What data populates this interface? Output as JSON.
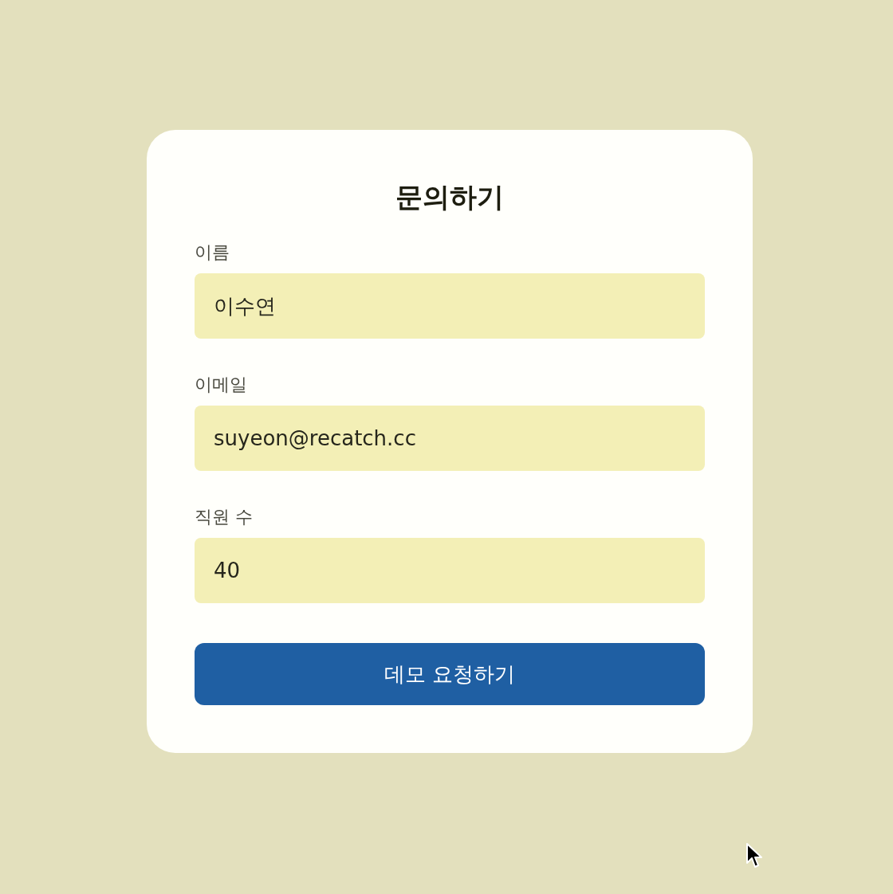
{
  "form": {
    "title": "문의하기",
    "fields": [
      {
        "label": "이름",
        "value": "이수연"
      },
      {
        "label": "이메일",
        "value": "suyeon@recatch.cc"
      },
      {
        "label": "직원 수",
        "value": "40"
      }
    ],
    "submit_button": "데모 요청하기"
  }
}
